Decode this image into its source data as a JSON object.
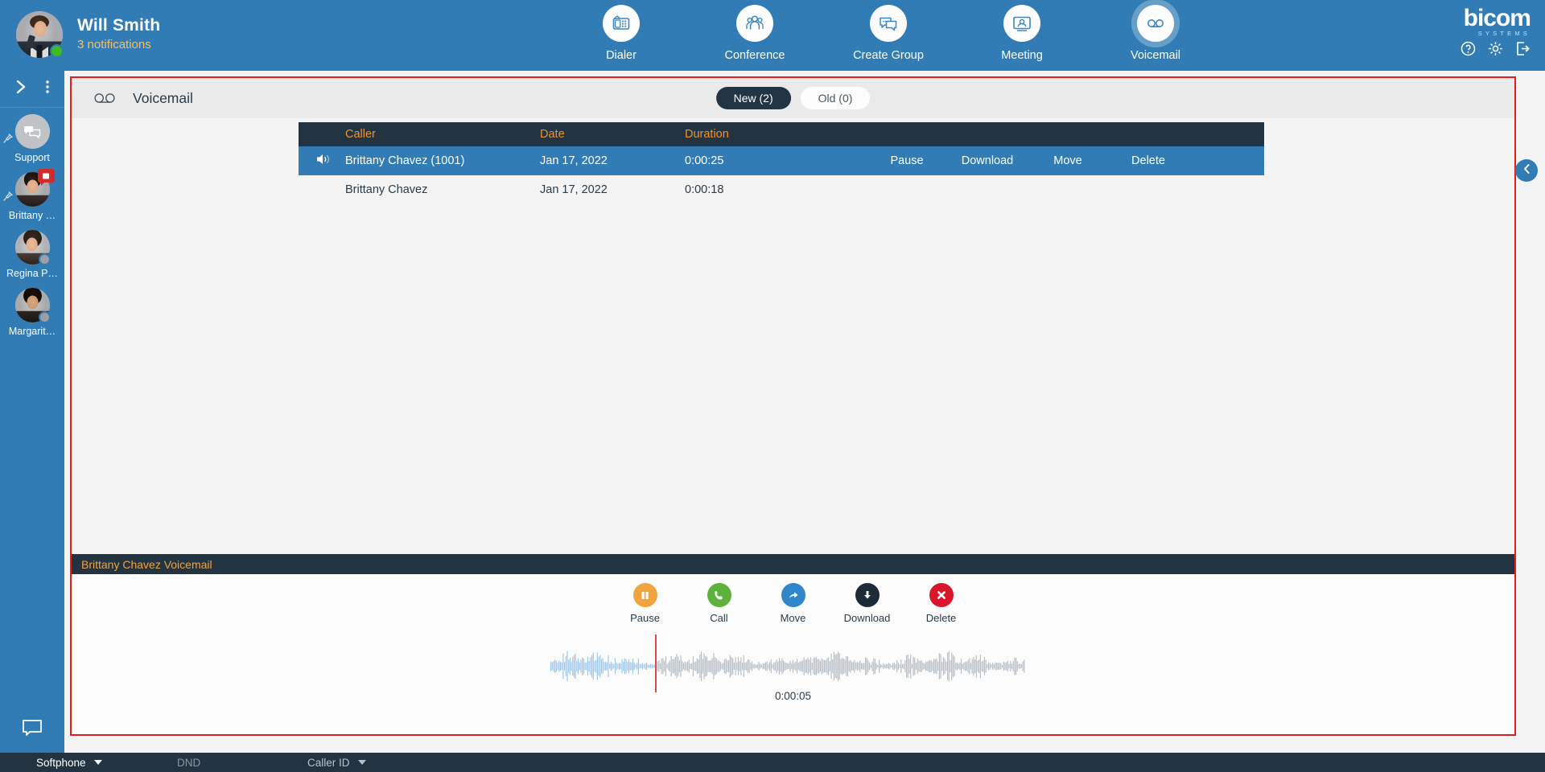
{
  "topbar": {
    "user_name": "Will Smith",
    "notifications": "3 notifications",
    "avatar_name": "user-avatar",
    "nav": [
      {
        "label": "Dialer",
        "icon": "desk-phone-icon",
        "active": false
      },
      {
        "label": "Conference",
        "icon": "people-group-icon",
        "active": false
      },
      {
        "label": "Create Group",
        "icon": "chat-bubbles-icon",
        "active": false
      },
      {
        "label": "Meeting",
        "icon": "video-screen-icon",
        "active": false
      },
      {
        "label": "Voicemail",
        "icon": "voicemail-icon",
        "active": true
      }
    ],
    "brand_name": "bicom",
    "brand_sub": "SYSTEMS",
    "brand_icons": [
      "help-icon",
      "gear-icon",
      "logout-icon"
    ]
  },
  "sidebar": {
    "expand_icon": "chevron-right-icon",
    "more_icon": "more-vertical-icon",
    "contacts": [
      {
        "label": "Support",
        "type": "group",
        "pinned": true,
        "badge": false,
        "presence": "none"
      },
      {
        "label": "Brittany …",
        "type": "person",
        "pinned": true,
        "badge": true,
        "presence": "none"
      },
      {
        "label": "Regina P…",
        "type": "person",
        "pinned": false,
        "badge": false,
        "presence": "offline"
      },
      {
        "label": "Margarit…",
        "type": "person",
        "pinned": false,
        "badge": false,
        "presence": "offline"
      }
    ],
    "chat_icon": "chat-bubble-icon"
  },
  "panel": {
    "icon": "voicemail-icon",
    "title": "Voicemail",
    "tabs": [
      {
        "label": "New (2)",
        "active": true
      },
      {
        "label": "Old (0)",
        "active": false
      }
    ],
    "collapse_icon": "chevron-left-icon"
  },
  "table": {
    "columns": [
      "Caller",
      "Date",
      "Duration"
    ],
    "rows": [
      {
        "caller": "Brittany Chavez (1001)",
        "date": "Jan 17, 2022",
        "duration": "0:00:25",
        "selected": true,
        "actions": [
          "Pause",
          "Download",
          "Move",
          "Delete"
        ]
      },
      {
        "caller": "Brittany Chavez",
        "date": "Jan 17, 2022",
        "duration": "0:00:18",
        "selected": false,
        "actions": []
      }
    ]
  },
  "player": {
    "title": "Brittany Chavez Voicemail",
    "actions": [
      {
        "label": "Pause",
        "icon": "pause-icon",
        "color": "#f0a33e"
      },
      {
        "label": "Call",
        "icon": "phone-icon",
        "color": "#5cb23a"
      },
      {
        "label": "Move",
        "icon": "forward-icon",
        "color": "#2f86cb"
      },
      {
        "label": "Download",
        "icon": "download-icon",
        "color": "#1d2b38"
      },
      {
        "label": "Delete",
        "icon": "close-x-icon",
        "color": "#d8172a"
      }
    ],
    "current_time": "0:00:05",
    "playhead_color": "#e04a4a",
    "wave_played_color": "#9cc7ec",
    "wave_remaining_color": "#b6bdc4"
  },
  "statusbar": {
    "softphone": "Softphone",
    "dnd": "DND",
    "caller_id": "Caller ID"
  },
  "colors": {
    "brand_blue": "#317cb5",
    "dark_navy": "#223442",
    "accent_orange": "#f0932b",
    "frame_red": "#e51c1c"
  }
}
